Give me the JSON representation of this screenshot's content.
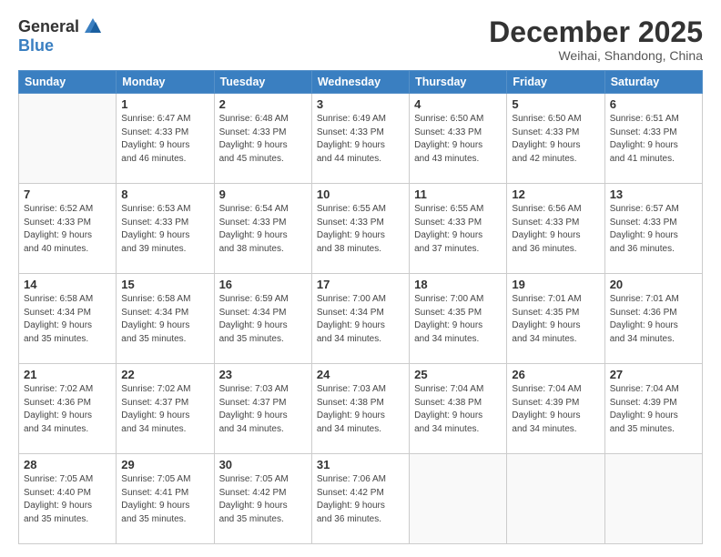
{
  "logo": {
    "general": "General",
    "blue": "Blue"
  },
  "header": {
    "month": "December 2025",
    "location": "Weihai, Shandong, China"
  },
  "days_of_week": [
    "Sunday",
    "Monday",
    "Tuesday",
    "Wednesday",
    "Thursday",
    "Friday",
    "Saturday"
  ],
  "weeks": [
    [
      {
        "day": "",
        "info": ""
      },
      {
        "day": "1",
        "info": "Sunrise: 6:47 AM\nSunset: 4:33 PM\nDaylight: 9 hours\nand 46 minutes."
      },
      {
        "day": "2",
        "info": "Sunrise: 6:48 AM\nSunset: 4:33 PM\nDaylight: 9 hours\nand 45 minutes."
      },
      {
        "day": "3",
        "info": "Sunrise: 6:49 AM\nSunset: 4:33 PM\nDaylight: 9 hours\nand 44 minutes."
      },
      {
        "day": "4",
        "info": "Sunrise: 6:50 AM\nSunset: 4:33 PM\nDaylight: 9 hours\nand 43 minutes."
      },
      {
        "day": "5",
        "info": "Sunrise: 6:50 AM\nSunset: 4:33 PM\nDaylight: 9 hours\nand 42 minutes."
      },
      {
        "day": "6",
        "info": "Sunrise: 6:51 AM\nSunset: 4:33 PM\nDaylight: 9 hours\nand 41 minutes."
      }
    ],
    [
      {
        "day": "7",
        "info": "Sunrise: 6:52 AM\nSunset: 4:33 PM\nDaylight: 9 hours\nand 40 minutes."
      },
      {
        "day": "8",
        "info": "Sunrise: 6:53 AM\nSunset: 4:33 PM\nDaylight: 9 hours\nand 39 minutes."
      },
      {
        "day": "9",
        "info": "Sunrise: 6:54 AM\nSunset: 4:33 PM\nDaylight: 9 hours\nand 38 minutes."
      },
      {
        "day": "10",
        "info": "Sunrise: 6:55 AM\nSunset: 4:33 PM\nDaylight: 9 hours\nand 38 minutes."
      },
      {
        "day": "11",
        "info": "Sunrise: 6:55 AM\nSunset: 4:33 PM\nDaylight: 9 hours\nand 37 minutes."
      },
      {
        "day": "12",
        "info": "Sunrise: 6:56 AM\nSunset: 4:33 PM\nDaylight: 9 hours\nand 36 minutes."
      },
      {
        "day": "13",
        "info": "Sunrise: 6:57 AM\nSunset: 4:33 PM\nDaylight: 9 hours\nand 36 minutes."
      }
    ],
    [
      {
        "day": "14",
        "info": "Sunrise: 6:58 AM\nSunset: 4:34 PM\nDaylight: 9 hours\nand 35 minutes."
      },
      {
        "day": "15",
        "info": "Sunrise: 6:58 AM\nSunset: 4:34 PM\nDaylight: 9 hours\nand 35 minutes."
      },
      {
        "day": "16",
        "info": "Sunrise: 6:59 AM\nSunset: 4:34 PM\nDaylight: 9 hours\nand 35 minutes."
      },
      {
        "day": "17",
        "info": "Sunrise: 7:00 AM\nSunset: 4:34 PM\nDaylight: 9 hours\nand 34 minutes."
      },
      {
        "day": "18",
        "info": "Sunrise: 7:00 AM\nSunset: 4:35 PM\nDaylight: 9 hours\nand 34 minutes."
      },
      {
        "day": "19",
        "info": "Sunrise: 7:01 AM\nSunset: 4:35 PM\nDaylight: 9 hours\nand 34 minutes."
      },
      {
        "day": "20",
        "info": "Sunrise: 7:01 AM\nSunset: 4:36 PM\nDaylight: 9 hours\nand 34 minutes."
      }
    ],
    [
      {
        "day": "21",
        "info": "Sunrise: 7:02 AM\nSunset: 4:36 PM\nDaylight: 9 hours\nand 34 minutes."
      },
      {
        "day": "22",
        "info": "Sunrise: 7:02 AM\nSunset: 4:37 PM\nDaylight: 9 hours\nand 34 minutes."
      },
      {
        "day": "23",
        "info": "Sunrise: 7:03 AM\nSunset: 4:37 PM\nDaylight: 9 hours\nand 34 minutes."
      },
      {
        "day": "24",
        "info": "Sunrise: 7:03 AM\nSunset: 4:38 PM\nDaylight: 9 hours\nand 34 minutes."
      },
      {
        "day": "25",
        "info": "Sunrise: 7:04 AM\nSunset: 4:38 PM\nDaylight: 9 hours\nand 34 minutes."
      },
      {
        "day": "26",
        "info": "Sunrise: 7:04 AM\nSunset: 4:39 PM\nDaylight: 9 hours\nand 34 minutes."
      },
      {
        "day": "27",
        "info": "Sunrise: 7:04 AM\nSunset: 4:39 PM\nDaylight: 9 hours\nand 35 minutes."
      }
    ],
    [
      {
        "day": "28",
        "info": "Sunrise: 7:05 AM\nSunset: 4:40 PM\nDaylight: 9 hours\nand 35 minutes."
      },
      {
        "day": "29",
        "info": "Sunrise: 7:05 AM\nSunset: 4:41 PM\nDaylight: 9 hours\nand 35 minutes."
      },
      {
        "day": "30",
        "info": "Sunrise: 7:05 AM\nSunset: 4:42 PM\nDaylight: 9 hours\nand 35 minutes."
      },
      {
        "day": "31",
        "info": "Sunrise: 7:06 AM\nSunset: 4:42 PM\nDaylight: 9 hours\nand 36 minutes."
      },
      {
        "day": "",
        "info": ""
      },
      {
        "day": "",
        "info": ""
      },
      {
        "day": "",
        "info": ""
      }
    ]
  ]
}
